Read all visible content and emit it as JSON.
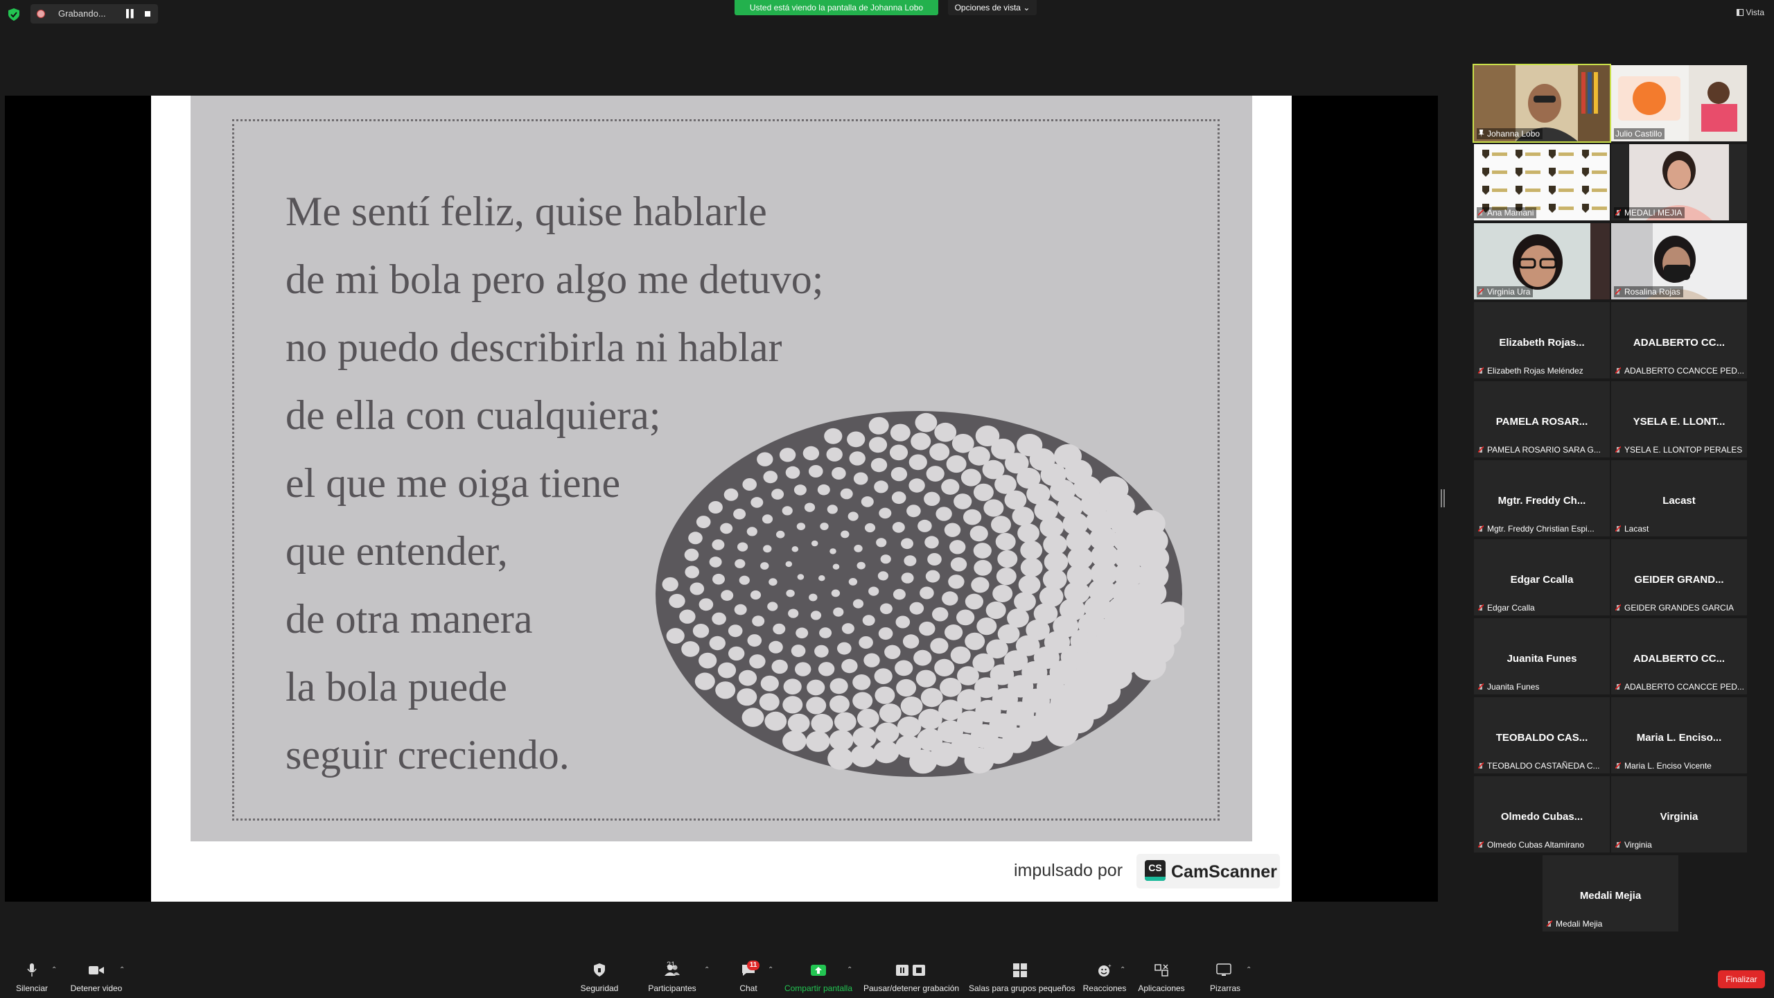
{
  "topbar": {
    "recording_label": "Grabando...",
    "viewing_banner": "Usted está viendo la pantalla de Johanna Lobo",
    "view_options": "Opciones de vista",
    "view_label": "Vista"
  },
  "shared_content": {
    "poem_lines": [
      "Me sentí feliz, quise hablarle",
      "de mi bola pero algo me detuvo;",
      "no puedo describirla ni hablar",
      "de ella con cualquiera;",
      "el que me oiga tiene",
      "que entender,",
      "de otra manera",
      "la bola puede",
      "seguir creciendo."
    ],
    "powered_by": "impulsado por",
    "brand_logo": "CS",
    "brand_name": "CamScanner"
  },
  "gallery": [
    {
      "label": "Johanna Lobo",
      "video": true,
      "active": true
    },
    {
      "label": "Julio Castillo",
      "video": true
    },
    {
      "label": "Ana Mamani",
      "video": true
    },
    {
      "label": "MEDALI MEJIA",
      "video": true
    },
    {
      "label": "Virginia Ura",
      "video": true
    },
    {
      "label": "Rosalina Rojas",
      "video": true
    },
    {
      "name": "Elizabeth  Rojas...",
      "label": "Elizabeth Rojas Meléndez"
    },
    {
      "name": "ADALBERTO CC...",
      "label": "ADALBERTO CCANCCE PED..."
    },
    {
      "name": "PAMELA  ROSAR...",
      "label": "PAMELA ROSARIO SARA G..."
    },
    {
      "name": "YSELA E. LLONT...",
      "label": "YSELA E. LLONTOP PERALES"
    },
    {
      "name": "Mgtr.  Freddy  Ch...",
      "label": "Mgtr. Freddy Christian Espi..."
    },
    {
      "name": "Lacast",
      "label": "Lacast"
    },
    {
      "name": "Edgar Ccalla",
      "label": "Edgar Ccalla"
    },
    {
      "name": "GEIDER  GRAND...",
      "label": "GEIDER GRANDES GARCIA"
    },
    {
      "name": "Juanita Funes",
      "label": "Juanita Funes"
    },
    {
      "name": "ADALBERTO CC...",
      "label": "ADALBERTO CCANCCE PED..."
    },
    {
      "name": "TEOBALDO  CAS...",
      "label": "TEOBALDO CASTAÑEDA C..."
    },
    {
      "name": "Maria  L.  Enciso...",
      "label": "Maria L. Enciso Vicente"
    },
    {
      "name": "Olmedo  Cubas...",
      "label": "Olmedo Cubas Altamirano"
    },
    {
      "name": "Virginia",
      "label": "Virginia"
    },
    {
      "name": "Medali Mejia",
      "label": "Medali Mejia"
    }
  ],
  "toolbar": {
    "mute": "Silenciar",
    "stop_video": "Detener video",
    "security": "Seguridad",
    "participants": "Participantes",
    "participants_count": "21",
    "chat": "Chat",
    "chat_badge": "11",
    "share_screen": "Compartir pantalla",
    "record": "Pausar/detener grabación",
    "breakout": "Salas para grupos pequeños",
    "reactions": "Reacciones",
    "apps": "Aplicaciones",
    "whiteboards": "Pizarras",
    "end": "Finalizar"
  },
  "colors": {
    "background": "#1a1a1a",
    "banner_green": "#23b14d",
    "active_speaker": "#c9e04a",
    "end_red": "#e02828"
  }
}
